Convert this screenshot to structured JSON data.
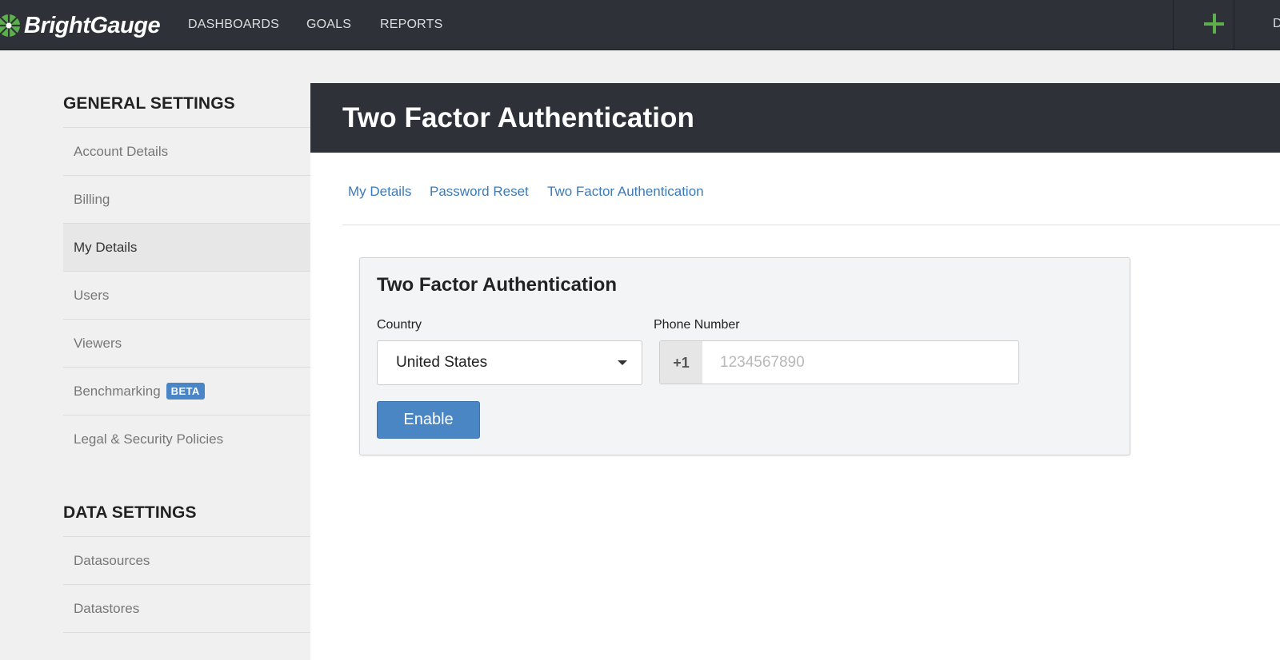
{
  "brand": {
    "name": "BrightGauge",
    "accent": "#5cb04b"
  },
  "nav": {
    "items": [
      {
        "label": "DASHBOARDS"
      },
      {
        "label": "GOALS"
      },
      {
        "label": "REPORTS"
      }
    ],
    "add_icon": "plus-icon",
    "cut_label": "D"
  },
  "sidebar": {
    "general_title": "GENERAL SETTINGS",
    "general_items": [
      {
        "label": "Account Details"
      },
      {
        "label": "Billing"
      },
      {
        "label": "My Details"
      },
      {
        "label": "Users"
      },
      {
        "label": "Viewers"
      },
      {
        "label": "Benchmarking",
        "badge": "BETA"
      },
      {
        "label": "Legal & Security Policies"
      }
    ],
    "data_title": "DATA SETTINGS",
    "data_items": [
      {
        "label": "Datasources"
      },
      {
        "label": "Datastores"
      }
    ]
  },
  "main": {
    "title": "Two Factor Authentication",
    "tabs": [
      {
        "label": "My Details"
      },
      {
        "label": "Password Reset"
      },
      {
        "label": "Two Factor Authentication"
      }
    ]
  },
  "card": {
    "title": "Two Factor Authentication",
    "country_label": "Country",
    "country_value": "United States",
    "phone_label": "Phone Number",
    "phone_prefix": "+1",
    "phone_placeholder": "1234567890",
    "enable_label": "Enable"
  }
}
